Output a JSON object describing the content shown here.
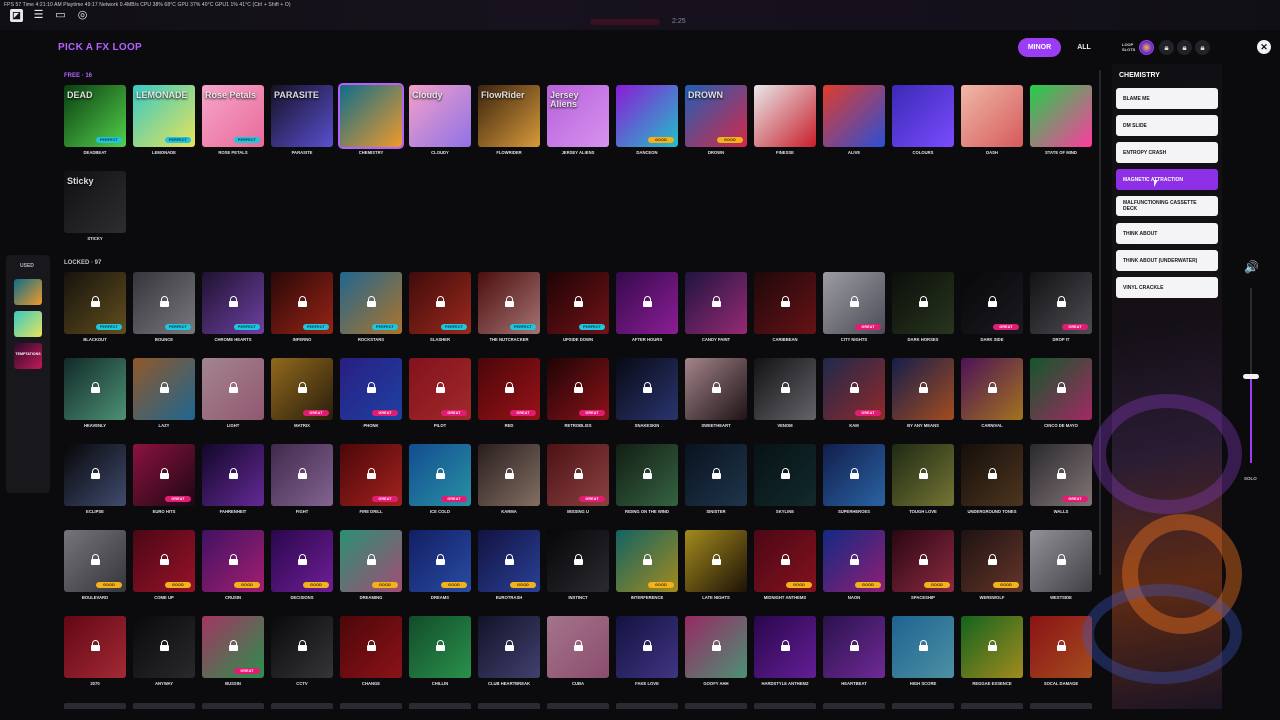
{
  "system_bar": {
    "stats": "FPS 57  Time 4:21:10 AM  Playtime 49:17  Network 0.4MB/s  CPU 38% 68°C  GPU 37% 40°C  GPU1 1% 41°C  (Ctrl + Shift + O)",
    "timer": "2:25"
  },
  "header": {
    "title": "PICK A FX LOOP",
    "mode_minor": "MINOR",
    "mode_all": "ALL",
    "loop_slots_label": "LOOP SLOTS",
    "close_symbol": "✕"
  },
  "sections": {
    "free_label": "FREE · 16",
    "locked_label": "LOCKED · 97",
    "used_label": "USED"
  },
  "used_items": [
    {
      "label": ""
    },
    {
      "label": ""
    },
    {
      "label": "TEMPTATIONS"
    }
  ],
  "free_loops": [
    {
      "name": "DEADBEAT",
      "tag": "PERFECT",
      "art": "DEAD",
      "colors": [
        "#0b3d12",
        "#52d14a"
      ]
    },
    {
      "name": "LEMONADE",
      "tag": "PERFECT",
      "art": "LEMONADE",
      "colors": [
        "#38c9c2",
        "#e9e35a"
      ]
    },
    {
      "name": "ROSE PETALS",
      "tag": "PERFECT",
      "art": "Rose Petals",
      "colors": [
        "#f6a6c9",
        "#e86a9a"
      ]
    },
    {
      "name": "PARASITE",
      "tag": "",
      "art": "PARASITE",
      "colors": [
        "#141225",
        "#5a4fd0"
      ]
    },
    {
      "name": "CHEMISTRY",
      "tag": "",
      "art": "",
      "colors": [
        "#0e6e8a",
        "#f09a2a"
      ]
    },
    {
      "name": "CLOUDY",
      "tag": "",
      "art": "Cloudy",
      "colors": [
        "#f3a0c9",
        "#8f72e6"
      ]
    },
    {
      "name": "FLOWRIDER",
      "tag": "",
      "art": "FlowRider",
      "colors": [
        "#3a2410",
        "#d99a3a"
      ]
    },
    {
      "name": "JERSEY ALIENS",
      "tag": "",
      "art": "Jersey Aliens",
      "colors": [
        "#b760d9",
        "#d693ef"
      ]
    },
    {
      "name": "DANCEON",
      "tag": "GOOD",
      "art": "",
      "colors": [
        "#8a1bd6",
        "#22c0c9"
      ]
    },
    {
      "name": "DROWN",
      "tag": "GOOD",
      "art": "DROWN",
      "colors": [
        "#1e5fb6",
        "#d62848"
      ]
    },
    {
      "name": "FINESSE",
      "tag": "",
      "art": "",
      "colors": [
        "#e8e8ea",
        "#c81e2a"
      ]
    },
    {
      "name": "ALIVE",
      "tag": "",
      "art": "",
      "colors": [
        "#e23c2a",
        "#2a4fd6"
      ]
    },
    {
      "name": "COLOURS",
      "tag": "",
      "art": "",
      "colors": [
        "#3a2ab5",
        "#7a4bff"
      ]
    },
    {
      "name": "DASH",
      "tag": "",
      "art": "",
      "colors": [
        "#f0b8a8",
        "#d55a5a"
      ]
    },
    {
      "name": "STATE OF MIND",
      "tag": "",
      "art": "",
      "colors": [
        "#21d04a",
        "#ff3aa0"
      ]
    },
    {
      "name": "STICKY",
      "tag": "",
      "art": "Sticky",
      "colors": [
        "#101012",
        "#2e2e32"
      ]
    }
  ],
  "locked_loops": [
    {
      "name": "BLACKOUT",
      "tag": "PERFECT",
      "colors": [
        "#1e1a12",
        "#8a6e2a"
      ]
    },
    {
      "name": "BOUNCE",
      "tag": "PERFECT",
      "colors": [
        "#4a4a52",
        "#a6a6ae"
      ]
    },
    {
      "name": "CHROME HEARTS",
      "tag": "PERFECT",
      "colors": [
        "#2a1a44",
        "#9a5ae0"
      ]
    },
    {
      "name": "INFERNO",
      "tag": "PERFECT",
      "colors": [
        "#3a0c0c",
        "#d2321e"
      ]
    },
    {
      "name": "ROCKSTARS",
      "tag": "PERFECT",
      "colors": [
        "#2e8ec9",
        "#f0a23a"
      ]
    },
    {
      "name": "SLASHER",
      "tag": "PERFECT",
      "colors": [
        "#5a1010",
        "#d63a2a"
      ]
    },
    {
      "name": "THE NUTCRACKER",
      "tag": "PERFECT",
      "colors": [
        "#6a1414",
        "#e4a0a0"
      ]
    },
    {
      "name": "UPSIDE DOWN",
      "tag": "PERFECT",
      "colors": [
        "#2a0608",
        "#9e1a22"
      ]
    },
    {
      "name": "AFTER HOURS",
      "tag": "",
      "colors": [
        "#4a0e6a",
        "#c22ad0"
      ]
    },
    {
      "name": "CANDY PAINT",
      "tag": "",
      "colors": [
        "#2a1e5a",
        "#d23aa0"
      ]
    },
    {
      "name": "CARIBBEAN",
      "tag": "",
      "colors": [
        "#2a0c0e",
        "#8e1a20"
      ]
    },
    {
      "name": "CITY NIGHTS",
      "tag": "GREAT",
      "colors": [
        "#d8d8e2",
        "#6a6a7a"
      ]
    },
    {
      "name": "DARK HORSES",
      "tag": "",
      "colors": [
        "#0e1610",
        "#3a4a2a"
      ]
    },
    {
      "name": "DARK SIDE",
      "tag": "GREAT",
      "colors": [
        "#0c0c10",
        "#24242c"
      ]
    },
    {
      "name": "DROP IT",
      "tag": "GREAT",
      "colors": [
        "#1a1a1e",
        "#6a6a72"
      ]
    },
    {
      "name": "HEAVENLY",
      "tag": "",
      "colors": [
        "#1a3a3a",
        "#6acaa2"
      ]
    },
    {
      "name": "LAZY",
      "tag": "",
      "colors": [
        "#c97a3a",
        "#2a8ec9"
      ]
    },
    {
      "name": "LIGHT",
      "tag": "",
      "colors": [
        "#e2b8c9",
        "#c97a9a"
      ]
    },
    {
      "name": "MATRIX",
      "tag": "GREAT",
      "colors": [
        "#c9922a",
        "#3a2a10"
      ]
    },
    {
      "name": "PHONK",
      "tag": "GREAT",
      "colors": [
        "#3a2ab5",
        "#2a5ae0"
      ]
    },
    {
      "name": "PILOT",
      "tag": "GREAT",
      "colors": [
        "#b51a2a",
        "#e03a3a"
      ]
    },
    {
      "name": "RED",
      "tag": "GREAT",
      "colors": [
        "#6a0a0e",
        "#d21a22"
      ]
    },
    {
      "name": "RETROBLISS",
      "tag": "GREAT",
      "colors": [
        "#2a0608",
        "#c21a22"
      ]
    },
    {
      "name": "SNAKESKIN",
      "tag": "",
      "colors": [
        "#0c0e1e",
        "#3a4a9a"
      ]
    },
    {
      "name": "SWEETHEART",
      "tag": "",
      "colors": [
        "#e2b8c0",
        "#2a1a1e"
      ]
    },
    {
      "name": "VENOM",
      "tag": "",
      "colors": [
        "#1a1a1e",
        "#8a8a92"
      ]
    },
    {
      "name": "KAM",
      "tag": "GREAT",
      "colors": [
        "#2a3a6a",
        "#c93a3a"
      ]
    },
    {
      "name": "BY ANY MEANS",
      "tag": "",
      "colors": [
        "#1e2a6a",
        "#e26a2a"
      ]
    },
    {
      "name": "CARNIVAL",
      "tag": "",
      "colors": [
        "#6a1a7a",
        "#e2a02a"
      ]
    },
    {
      "name": "CINCO DE MAYO",
      "tag": "",
      "colors": [
        "#1a7a3a",
        "#e23a8a"
      ]
    },
    {
      "name": "ECLIPSE",
      "tag": "",
      "colors": [
        "#0a0a0e",
        "#5a6a9a"
      ]
    },
    {
      "name": "EURO HITS",
      "tag": "GREAT",
      "colors": [
        "#c21a5a",
        "#2a0a1a"
      ]
    },
    {
      "name": "FAHRENHEIT",
      "tag": "",
      "colors": [
        "#1a0a3a",
        "#8a3ad0"
      ]
    },
    {
      "name": "FIGHT",
      "tag": "",
      "colors": [
        "#5a3a6a",
        "#b58ac9"
      ]
    },
    {
      "name": "FIRE DRILL",
      "tag": "GREAT",
      "colors": [
        "#6a0a0e",
        "#e2302a"
      ]
    },
    {
      "name": "ICE COLD",
      "tag": "GREAT",
      "colors": [
        "#1a6ac9",
        "#3ac9e2"
      ]
    },
    {
      "name": "KARMA",
      "tag": "",
      "colors": [
        "#3a2a2a",
        "#b59a8a"
      ]
    },
    {
      "name": "MISSING U",
      "tag": "GREAT",
      "colors": [
        "#6a1a1e",
        "#c25a5a"
      ]
    },
    {
      "name": "RIDING ON THE WIND",
      "tag": "",
      "colors": [
        "#1a2a1e",
        "#4a8a5a"
      ]
    },
    {
      "name": "SINISTER",
      "tag": "",
      "colors": [
        "#0e1a2a",
        "#2a4a6a"
      ]
    },
    {
      "name": "SKYLINE",
      "tag": "",
      "colors": [
        "#0a1a1e",
        "#1a3a3e"
      ]
    },
    {
      "name": "SUPERHEROES",
      "tag": "",
      "colors": [
        "#1a2a6a",
        "#3a8ae2"
      ]
    },
    {
      "name": "TOUGH LOVE",
      "tag": "",
      "colors": [
        "#2a3a1a",
        "#a2a24a"
      ]
    },
    {
      "name": "UNDERGROUND TONES",
      "tag": "",
      "colors": [
        "#1e1410",
        "#6a4a2a"
      ]
    },
    {
      "name": "WALLS",
      "tag": "GREAT",
      "colors": [
        "#3a3a42",
        "#b5a2a2"
      ]
    },
    {
      "name": "BOULEVARD",
      "tag": "GOOD",
      "colors": [
        "#a2a2aa",
        "#4a4a52"
      ]
    },
    {
      "name": "COME UP",
      "tag": "GOOD",
      "colors": [
        "#6a0a1e",
        "#d21a3a"
      ]
    },
    {
      "name": "CRUSIN",
      "tag": "GOOD",
      "colors": [
        "#5a1a8a",
        "#e22a9a"
      ]
    },
    {
      "name": "DECISIONS",
      "tag": "GOOD",
      "colors": [
        "#3a0a6a",
        "#9a2ad0"
      ]
    },
    {
      "name": "DREAMING",
      "tag": "GOOD",
      "colors": [
        "#3ac9a2",
        "#e26aa0"
      ]
    },
    {
      "name": "DREAMS",
      "tag": "GOOD",
      "colors": [
        "#1a2a8a",
        "#3a6ae2"
      ]
    },
    {
      "name": "EUROTRASH",
      "tag": "GOOD",
      "colors": [
        "#1a1a5a",
        "#3a5ad0"
      ]
    },
    {
      "name": "INSTINCT",
      "tag": "",
      "colors": [
        "#0a0a0e",
        "#3a3a42"
      ]
    },
    {
      "name": "INTERFERENCE",
      "tag": "GOOD",
      "colors": [
        "#1a8a8a",
        "#e2c02a"
      ]
    },
    {
      "name": "LATE NIGHTS",
      "tag": "",
      "colors": [
        "#e2c02a",
        "#2a1a0a"
      ]
    },
    {
      "name": "MIDNIGHT ANTHEMS",
      "tag": "GOOD",
      "colors": [
        "#6a0a1e",
        "#b51a2a"
      ]
    },
    {
      "name": "NAON",
      "tag": "GOOD",
      "colors": [
        "#1a3ab5",
        "#c92aa2"
      ]
    },
    {
      "name": "SPACESHIP",
      "tag": "GOOD",
      "colors": [
        "#3a0a1a",
        "#c23a5a"
      ]
    },
    {
      "name": "WEREWOLF",
      "tag": "GOOD",
      "colors": [
        "#2a1a1a",
        "#8a4a3a"
      ]
    },
    {
      "name": "WESTSIDE",
      "tag": "",
      "colors": [
        "#c9c9d2",
        "#5a5a62"
      ]
    },
    {
      "name": "2070",
      "tag": "",
      "colors": [
        "#8a0a1e",
        "#e23a4a"
      ]
    },
    {
      "name": "ANYWAY",
      "tag": "",
      "colors": [
        "#0e0e12",
        "#3a3a3e"
      ]
    },
    {
      "name": "BUSSIN",
      "tag": "GREAT",
      "colors": [
        "#e24a8a",
        "#3ac96a"
      ]
    },
    {
      "name": "CCTV",
      "tag": "",
      "colors": [
        "#0e0e10",
        "#4a4a4e"
      ]
    },
    {
      "name": "CHANGE",
      "tag": "",
      "colors": [
        "#6a0a0e",
        "#c21a22"
      ]
    },
    {
      "name": "CHILLIN",
      "tag": "",
      "colors": [
        "#1a6a3a",
        "#3ac96a"
      ]
    },
    {
      "name": "CLUB HEARTBREAK",
      "tag": "",
      "colors": [
        "#1a1a3a",
        "#5a5a9a"
      ]
    },
    {
      "name": "CUBA",
      "tag": "",
      "colors": [
        "#e2a2c0",
        "#c26a9a"
      ]
    },
    {
      "name": "FAKE LOVE",
      "tag": "",
      "colors": [
        "#1a1a5a",
        "#5a4ab5"
      ]
    },
    {
      "name": "GOOFY AHH",
      "tag": "",
      "colors": [
        "#d23a8a",
        "#6ac9a2"
      ]
    },
    {
      "name": "HARDSTYLE ANTHEMZ",
      "tag": "",
      "colors": [
        "#3a0a6a",
        "#8a2ad0"
      ]
    },
    {
      "name": "HEARTBEAT",
      "tag": "",
      "colors": [
        "#3a1a6a",
        "#9a3ad0"
      ]
    },
    {
      "name": "HIGH SCORE",
      "tag": "",
      "colors": [
        "#2a8ac9",
        "#6ac9e2"
      ]
    },
    {
      "name": "REGGAE ESSENCE",
      "tag": "",
      "colors": [
        "#1a8a2a",
        "#e2c02a"
      ]
    },
    {
      "name": "SOCAL DAMAGE",
      "tag": "",
      "colors": [
        "#c21a1e",
        "#e26a2a"
      ]
    }
  ],
  "side_panel": {
    "title": "CHEMISTRY",
    "options": [
      "BLAME ME",
      "DM SLIDE",
      "ENTROPY CRASH",
      "MAGNETIC ATTRACTION",
      "MALFUNCTIONING CASSETTE DECK",
      "THINK ABOUT",
      "THINK ABOUT (UNDERWATER)",
      "VINYL CRACKLE"
    ],
    "active_index": 3
  },
  "volume": {
    "level": 0.5,
    "solo_label": "SOLO",
    "speaker_symbol": "🔊"
  },
  "colors": {
    "accent": "#9b3df5",
    "title": "#b561ff",
    "tag_perfect": "#1fc6e0",
    "tag_good": "#f2b21b",
    "tag_great": "#e21c74"
  }
}
